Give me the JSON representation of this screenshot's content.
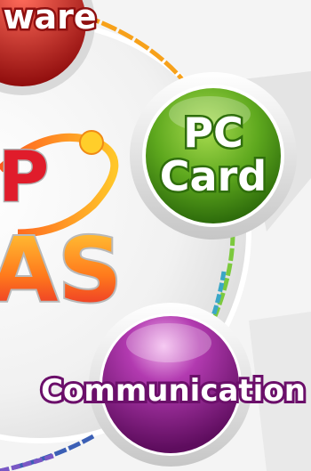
{
  "hardware_node": {
    "label": "ware",
    "color": "#c31f1f"
  },
  "pc_card_node": {
    "line1": "PC",
    "line2": "Card",
    "color": "#5ea81e"
  },
  "center_logo": {
    "letters_top": "P",
    "letters_bottom": "AS"
  },
  "communication_node": {
    "label": "Communication",
    "color": "#8a1a86"
  }
}
